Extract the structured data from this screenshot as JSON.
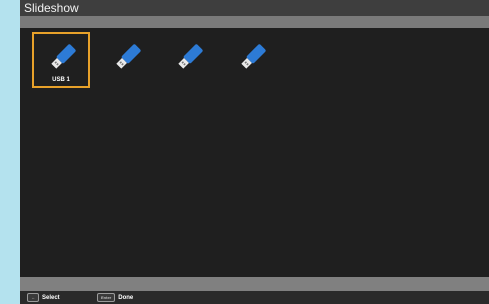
{
  "title": "Slideshow",
  "devices": [
    {
      "label": "USB 1",
      "selected": true,
      "icon": "usb-drive-icon"
    },
    {
      "label": "",
      "selected": false,
      "icon": "usb-drive-icon"
    },
    {
      "label": "",
      "selected": false,
      "icon": "usb-drive-icon"
    },
    {
      "label": "",
      "selected": false,
      "icon": "usb-drive-icon"
    }
  ],
  "status_bar": {
    "select_key": "↔",
    "select_label": "Select",
    "done_key": "Enter",
    "done_label": "Done"
  },
  "colors": {
    "selection_border": "#e7a12a",
    "usb_body": "#2d7bd6",
    "usb_connector": "#e9e9e9",
    "page_background": "#b4e2ee"
  }
}
